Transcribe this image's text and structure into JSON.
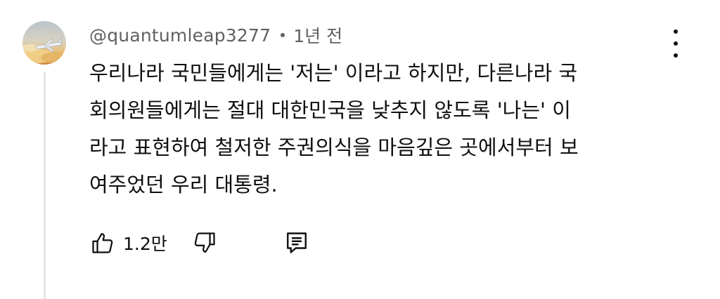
{
  "comment": {
    "author_handle": "@quantumleap3277",
    "timestamp": "1년 전",
    "text": "우리나라 국민들에게는 '저는' 이라고 하지만, 다른나라 국\n회의원들에게는 절대 대한민국을 낮추지 않도록 '나는' 이\n라고 표현하여 철저한 주권의식을 마음깊은 곳에서부터 보\n여주었던 우리 대통령.",
    "like_count": "1.2만"
  },
  "icons": {
    "avatar": "avatar-image",
    "more": "kebab-icon",
    "like": "thumbs-up-icon",
    "dislike": "thumbs-down-icon",
    "reply": "reply-comment-icon"
  },
  "colors": {
    "text_primary": "#0f0f0f",
    "text_secondary": "#606060",
    "thread_line": "#e5e5e5"
  }
}
